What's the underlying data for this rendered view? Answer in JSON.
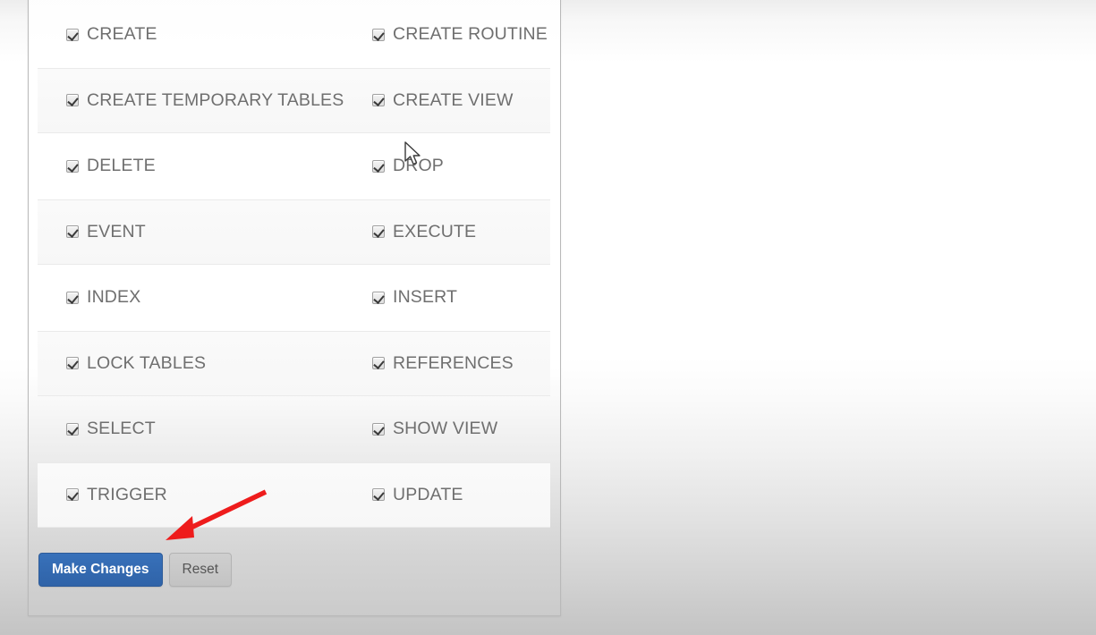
{
  "window": {
    "background_top": "#ededed",
    "background_bottom": "#c4c4c4"
  },
  "panel": {
    "name": "database-privileges-panel",
    "border_color": "#b9b9b9"
  },
  "privileges": {
    "checkbox_state": "checked",
    "rows": [
      {
        "striped": false,
        "left": {
          "label": "CREATE",
          "checked": true
        },
        "right": {
          "label": "CREATE ROUTINE",
          "checked": true
        }
      },
      {
        "striped": true,
        "left": {
          "label": "CREATE TEMPORARY TABLES",
          "checked": true
        },
        "right": {
          "label": "CREATE VIEW",
          "checked": true
        }
      },
      {
        "striped": false,
        "left": {
          "label": "DELETE",
          "checked": true
        },
        "right": {
          "label": "DROP",
          "checked": true
        }
      },
      {
        "striped": true,
        "left": {
          "label": "EVENT",
          "checked": true
        },
        "right": {
          "label": "EXECUTE",
          "checked": true
        }
      },
      {
        "striped": false,
        "left": {
          "label": "INDEX",
          "checked": true
        },
        "right": {
          "label": "INSERT",
          "checked": true
        }
      },
      {
        "striped": true,
        "left": {
          "label": "LOCK TABLES",
          "checked": true
        },
        "right": {
          "label": "REFERENCES",
          "checked": true
        }
      },
      {
        "striped": false,
        "left": {
          "label": "SELECT",
          "checked": true
        },
        "right": {
          "label": "SHOW VIEW",
          "checked": true
        }
      },
      {
        "striped": true,
        "left": {
          "label": "TRIGGER",
          "checked": true
        },
        "right": {
          "label": "UPDATE",
          "checked": true
        }
      }
    ]
  },
  "buttons": {
    "primary": {
      "label": "Make Changes",
      "background": "#3266ac",
      "text_color": "#ffffff"
    },
    "secondary": {
      "label": "Reset",
      "background": "#c8c8c8",
      "text_color": "#555555"
    }
  },
  "annotation": {
    "arrow_color": "#ee1c1c",
    "points_to": "Make Changes"
  },
  "cursor": {
    "type": "arrow-pointer",
    "over": "DROP"
  }
}
